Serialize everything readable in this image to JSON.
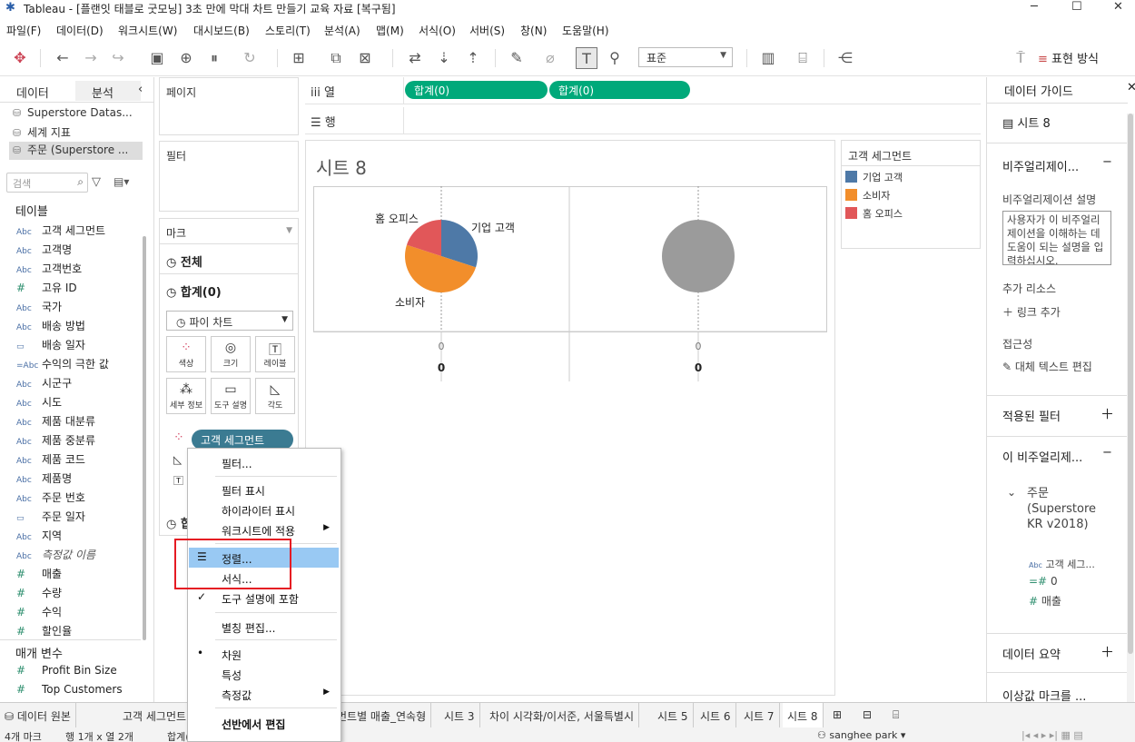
{
  "app": {
    "title": "Tableau - [플랜잇 태블로 굿모닝] 3초 만에 막대 차트 만들기 교육 자료 [복구됨]",
    "window_min": "─",
    "window_max": "☐",
    "window_close": "✕"
  },
  "menu": [
    "파일(F)",
    "데이터(D)",
    "워크시트(W)",
    "대시보드(B)",
    "스토리(T)",
    "분석(A)",
    "맵(M)",
    "서식(O)",
    "서버(S)",
    "창(N)",
    "도움말(H)"
  ],
  "toolbar": {
    "format_select": "표준",
    "show_me": "표현 방식"
  },
  "data_pane": {
    "tab_data": "데이터",
    "tab_analysis": "분석",
    "collapse": "‹",
    "sources": [
      "Superstore Datas...",
      "세계 지표",
      "주문 (Superstore ..."
    ],
    "search_placeholder": "검색",
    "tables_title": "테이블",
    "fields": [
      {
        "type": "Abc",
        "name": "고객 세그먼트"
      },
      {
        "type": "Abc",
        "name": "고객명"
      },
      {
        "type": "Abc",
        "name": "고객번호"
      },
      {
        "type": "#",
        "name": "고유 ID"
      },
      {
        "type": "Abc",
        "name": "국가"
      },
      {
        "type": "Abc",
        "name": "배송 방법"
      },
      {
        "type": "▭",
        "name": "배송 일자"
      },
      {
        "type": "=Abc",
        "name": "수익의 극한 값"
      },
      {
        "type": "Abc",
        "name": "시군구"
      },
      {
        "type": "Abc",
        "name": "시도"
      },
      {
        "type": "Abc",
        "name": "제품 대분류"
      },
      {
        "type": "Abc",
        "name": "제품 중분류"
      },
      {
        "type": "Abc",
        "name": "제품 코드"
      },
      {
        "type": "Abc",
        "name": "제품명"
      },
      {
        "type": "Abc",
        "name": "주문 번호"
      },
      {
        "type": "▭",
        "name": "주문 일자"
      },
      {
        "type": "Abc",
        "name": "지역"
      },
      {
        "type": "Abc",
        "name": "측정값 이름"
      },
      {
        "type": "#",
        "name": "매출"
      },
      {
        "type": "#",
        "name": "수량"
      },
      {
        "type": "#",
        "name": "수익"
      },
      {
        "type": "#",
        "name": "할인율"
      }
    ],
    "params_title": "매개 변수",
    "params": [
      {
        "type": "#",
        "name": "Profit Bin Size"
      },
      {
        "type": "#",
        "name": "Top Customers"
      }
    ]
  },
  "shelves": {
    "pages": "페이지",
    "filters": "필터",
    "columns_label": "열",
    "rows_label": "행",
    "columns_pills": [
      "합계(0)",
      "합계(0)"
    ]
  },
  "marks": {
    "title": "마크",
    "all": "전체",
    "sum": "합계(0)",
    "mark_type": "파이 차트",
    "buttons": {
      "color": "색상",
      "size": "크기",
      "label": "레이블",
      "detail": "세부 정보",
      "tooltip": "도구 설명",
      "angle": "각도"
    },
    "pill": "고객 세그먼트"
  },
  "sheet": {
    "title": "시트 8",
    "labels": {
      "home": "홈 오피스",
      "corp": "기업 고객",
      "consumer": "소비자"
    },
    "axis_left_a": "0",
    "axis_left_b": "0",
    "axis_right_a": "0",
    "axis_right_b": "0"
  },
  "chart_data": {
    "type": "pie",
    "categories": [
      "기업 고객",
      "소비자",
      "홈 오피스"
    ],
    "values": [
      30,
      50,
      20
    ],
    "colors": [
      "#4e79a7",
      "#f28e2b",
      "#e15759"
    ]
  },
  "legend": {
    "title": "고객 세그먼트",
    "items": [
      {
        "name": "기업 고객",
        "color": "#4e79a7"
      },
      {
        "name": "소비자",
        "color": "#f28e2b"
      },
      {
        "name": "홈 오피스",
        "color": "#e15759"
      }
    ]
  },
  "context_menu": {
    "items": [
      "필터...",
      "필터 표시",
      "하이라이터 표시",
      "워크시트에 적용",
      "정렬...",
      "서식...",
      "도구 설명에 포함",
      "별칭 편집...",
      "차원",
      "특성",
      "측정값",
      "선반에서 편집"
    ]
  },
  "guide": {
    "title": "데이터 가이드",
    "sheet": "시트 8",
    "viz_section": "비주얼리제이...",
    "desc_label": "비주얼리제이션 설명",
    "desc_text": "사용자가 이 비주얼리제이션을 이해하는 데 도움이 되는 설명을 입력하십시오.",
    "extra_resources": "추가 리소스",
    "add_link": "링크 추가",
    "accessibility": "접근성",
    "alt_text": "대체 텍스트 편집",
    "applied_filters": "적용된 필터",
    "this_viz": "이 비주얼리제...",
    "tree_source": "주문 (Superstore KR v2018)",
    "tree_fields": [
      "고객 세그...",
      "0",
      "매출"
    ],
    "data_summary": "데이터 요약",
    "outliers": "이상값 마크를 ..."
  },
  "tabs": [
    "데이터 원본",
    "고객 세그먼트",
    "먼트별 매출_연속형",
    "시트 3",
    "차이 시각화/이서준, 서울특별시",
    "시트 5",
    "시트 6",
    "시트 7",
    "시트 8"
  ],
  "status": {
    "marks": "4개 마크",
    "rows_cols": "행 1개 x 열 2개",
    "sum": "합계(",
    "user": "sanghee park"
  }
}
